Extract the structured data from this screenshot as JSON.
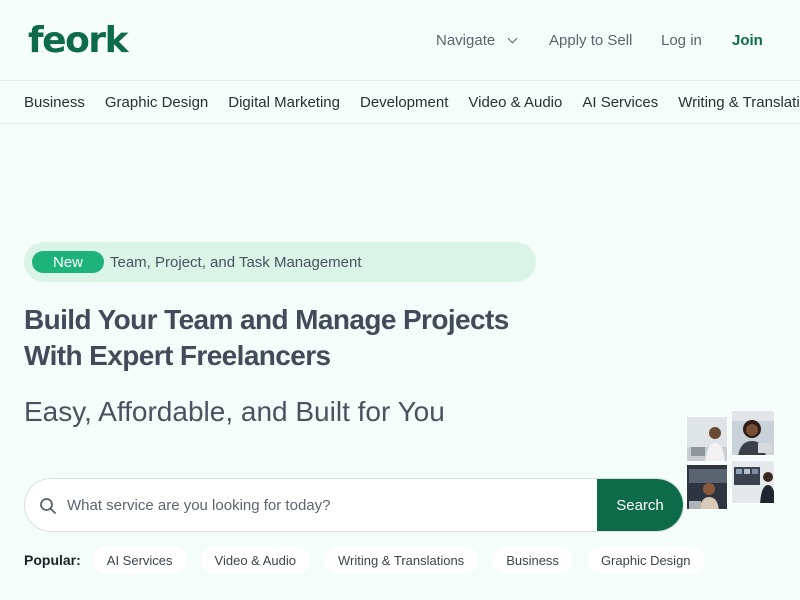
{
  "brand": {
    "logo_text": "feork",
    "color": "#0d6b4a"
  },
  "topnav": {
    "navigate": "Navigate",
    "apply": "Apply to Sell",
    "login": "Log in",
    "join": "Join"
  },
  "categories": [
    "Business",
    "Graphic Design",
    "Digital Marketing",
    "Development",
    "Video & Audio",
    "AI Services",
    "Writing & Translation"
  ],
  "hero": {
    "badge_pill": "New",
    "badge_text": "Team, Project, and Task Management",
    "headline_line1": "Build Your Team and Manage Projects",
    "headline_line2": "With Expert Freelancers",
    "subhead": "Easy, Affordable, and Built for You"
  },
  "search": {
    "placeholder": "What service are you looking for today?",
    "button": "Search",
    "icon": "search-icon"
  },
  "popular": {
    "label": "Popular:",
    "items": [
      "AI Services",
      "Video & Audio",
      "Writing & Translations",
      "Business",
      "Graphic Design"
    ]
  },
  "colors": {
    "page_bg": "#f4fdf9",
    "accent": "#0d6b4a",
    "badge_bg": "#daf5e8",
    "badge_pill": "#1fb37c"
  }
}
